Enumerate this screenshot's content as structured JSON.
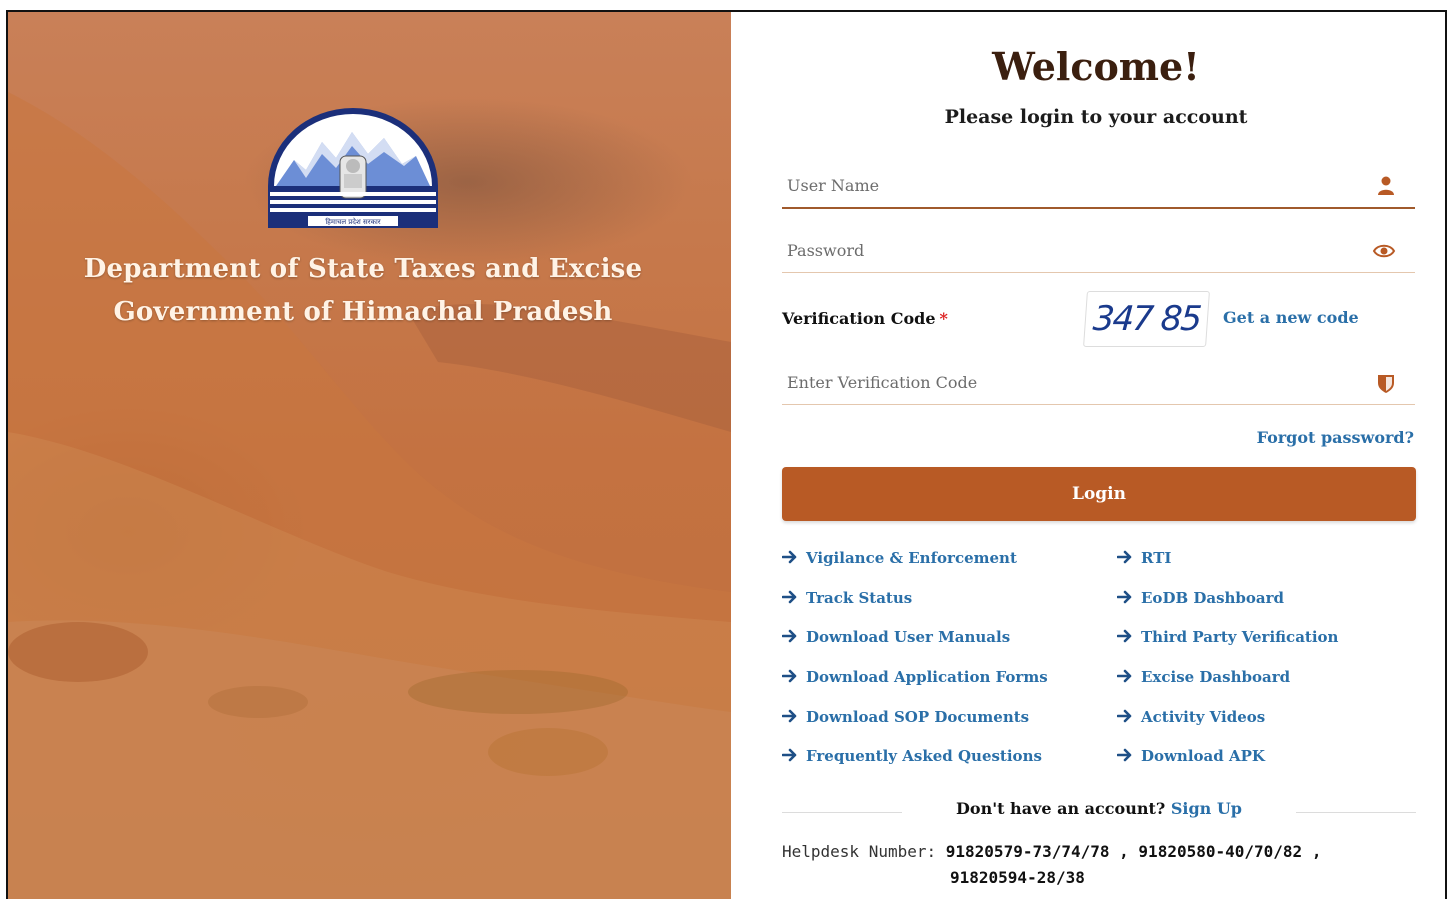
{
  "brand": {
    "department_line1": "Department of State Taxes and Excise",
    "department_line2": "Government of Himachal Pradesh",
    "emblem": "himachal-pradesh-emblem",
    "emblem_caption": "हिमाचल प्रदेश सरकार"
  },
  "login": {
    "welcome": "Welcome!",
    "subtitle": "Please login to your account",
    "username_placeholder": "User Name",
    "password_placeholder": "Password",
    "verification_label": "Verification Code",
    "required_mark": "*",
    "captcha_value": "347 85",
    "new_code_label": "Get a new code",
    "verification_placeholder": "Enter Verification Code",
    "forgot_label": "Forgot password?",
    "login_button": "Login"
  },
  "quick_links": {
    "left": [
      "Vigilance & Enforcement",
      "Track Status",
      "Download User Manuals",
      "Download Application Forms",
      "Download SOP Documents",
      "Frequently Asked Questions"
    ],
    "right": [
      "RTI",
      "EoDB Dashboard",
      "Third Party Verification",
      "Excise Dashboard",
      "Activity Videos",
      "Download APK"
    ]
  },
  "signup": {
    "prompt": "Don't have an account?",
    "link": "Sign Up"
  },
  "helpdesk": {
    "label": "Helpdesk Number:",
    "numbers_line1": "91820579-73/74/78 , 91820580-40/70/82 ,",
    "numbers_line2": "91820594-28/38"
  },
  "icons": {
    "username": "user-icon",
    "password": "eye-icon",
    "verification": "shield-icon",
    "link_arrow": "arrow-right-icon"
  },
  "colors": {
    "accent": "#b85a25",
    "link": "#2a6fa8",
    "heading": "#3b1f0f"
  }
}
